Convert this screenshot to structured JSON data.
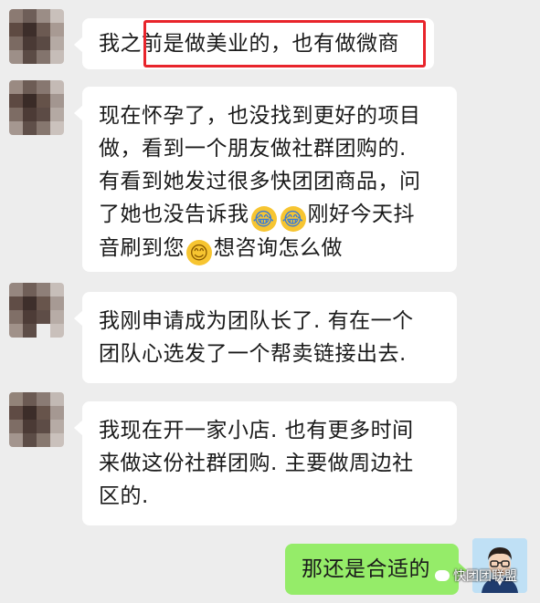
{
  "messages": [
    {
      "from": "other",
      "text": "我之前是做美业的，也有做微商"
    },
    {
      "from": "other",
      "lines": [
        "现在怀孕了，也没找到更好的项目",
        "做，看到一个朋友做社群团购的.",
        "有看到她发过很多快团团商品，问",
        "了她也没告诉我"
      ],
      "line4_tail": "刚好今天抖",
      "line5_head": "音刷到您",
      "line5_tail": "想咨询怎么做"
    },
    {
      "from": "other",
      "lines": [
        "我刚申请成为团队长了. 有在一个",
        "团队心选发了一个帮卖链接出去."
      ]
    },
    {
      "from": "other",
      "lines": [
        "我现在开一家小店. 也有更多时间",
        "来做这份社群团购. 主要做周边社",
        "区的."
      ]
    },
    {
      "from": "me",
      "text": "那还是合适的"
    }
  ],
  "emojis": {
    "laugh": "😂",
    "smile": "😊"
  },
  "watermark": "快团团联盟",
  "colors": {
    "me_bubble": "#95ec69",
    "highlight": "#e8242b",
    "background": "#ededed"
  }
}
